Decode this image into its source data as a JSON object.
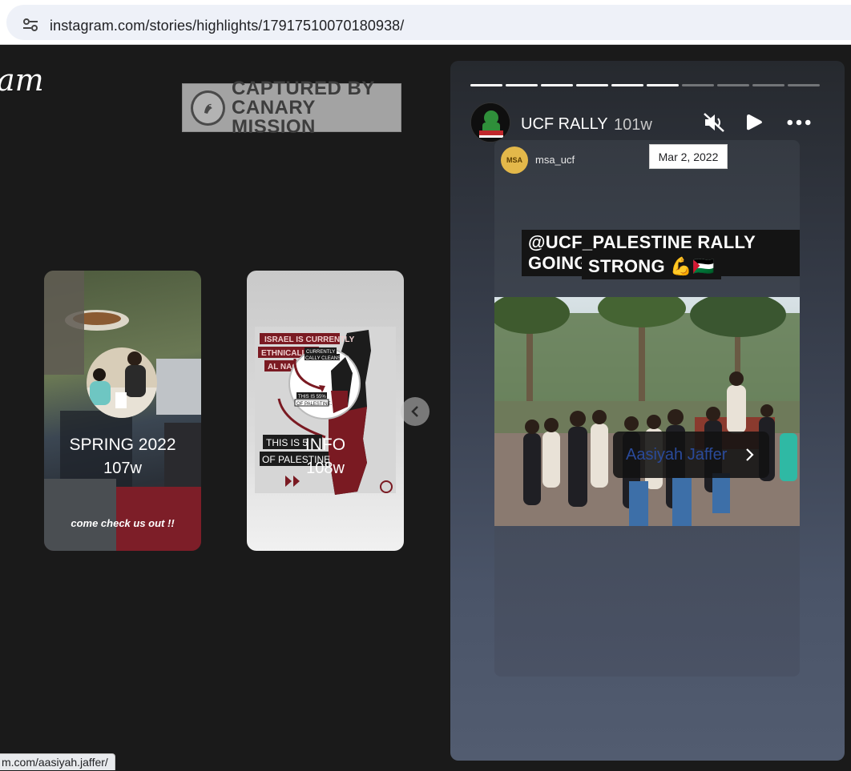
{
  "browser": {
    "url": "instagram.com/stories/highlights/17917510070180938/",
    "status_url": "m.com/aasiyah.jaffer/"
  },
  "page": {
    "logo_fragment": "am",
    "watermark": {
      "line1": "CAPTURED BY",
      "line2": "CANARY MISSION"
    }
  },
  "highlights": [
    {
      "title": "SPRING 2022",
      "age": "107w",
      "caption": "come check us out !!"
    },
    {
      "title": "INFO",
      "age": "108w",
      "graphic_text": {
        "israel_currently": "ISRAEL IS CURRENTLY",
        "ethnically": "ETHNICALLY C",
        "currently": "CURRENTLY",
        "cleansing": "CALLY CLEANSING",
        "naqab": "AL NAQAB",
        "this_is_55": "THIS IS 55%",
        "of_palestine_small": "OF PALESTINE.",
        "this_is_5": "THIS IS 5",
        "of_palestine": "OF PALESTINE"
      }
    }
  ],
  "story": {
    "username": "UCF RALLY",
    "age": "101w",
    "progress_total": 10,
    "progress_done": 6,
    "repost": {
      "avatar_text": "MSA",
      "username": "msa_ucf"
    },
    "caption_line1": "@UCF_PALESTINE RALLY GOING",
    "caption_line2": "STRONG 💪🇵🇸",
    "tag": "Aasiyah Jaffer",
    "date_tooltip": "Mar 2, 2022"
  },
  "icons": {
    "site_info": "tune-icon",
    "mute": "speaker-muted-icon",
    "play": "play-icon",
    "more": "more-horizontal-icon",
    "prev": "chevron-left-icon",
    "tag_chevron": "chevron-right-icon"
  }
}
